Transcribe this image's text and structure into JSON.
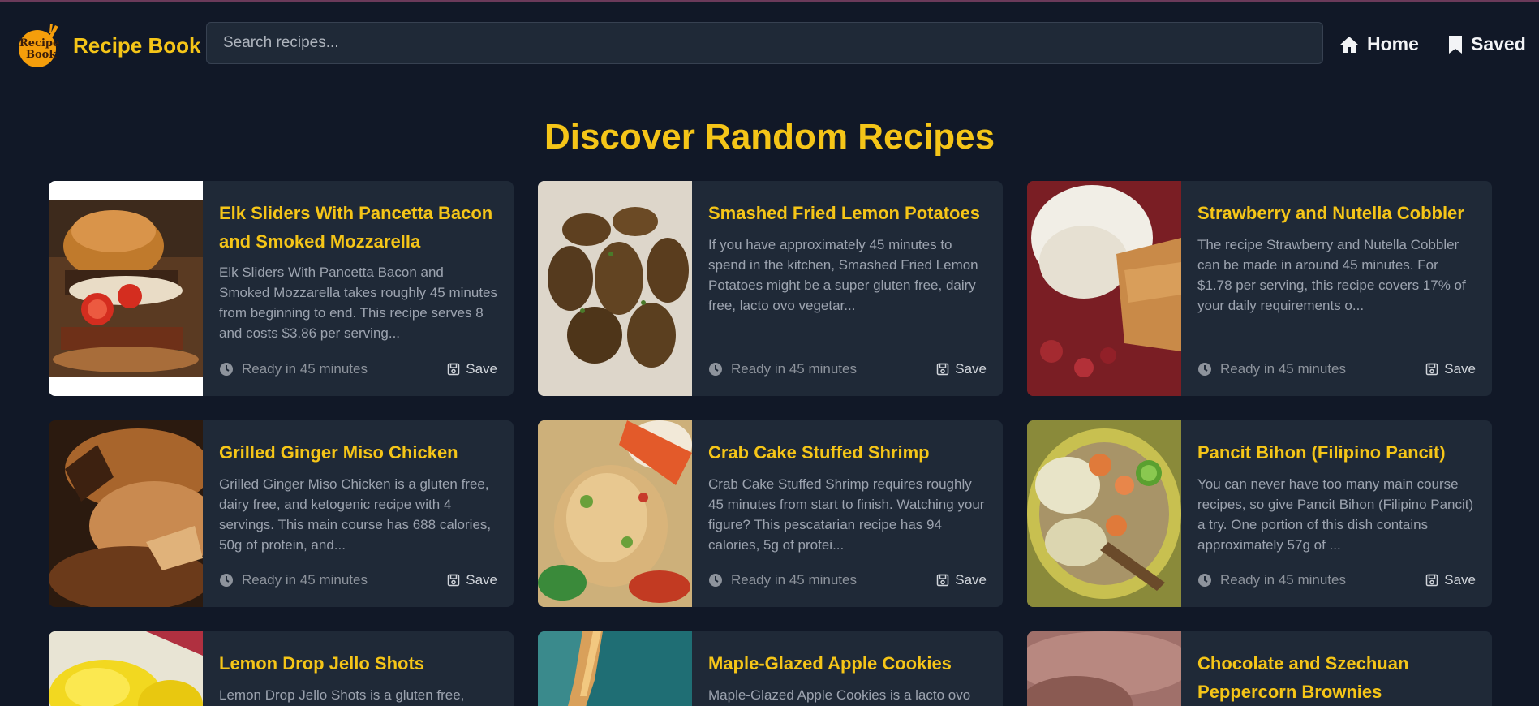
{
  "header": {
    "brand": "Recipe Book",
    "logo_text_line1": "Recipe",
    "logo_text_line2": "Book",
    "search_placeholder": "Search recipes...",
    "nav": [
      {
        "label": "Home",
        "icon": "home-icon"
      },
      {
        "label": "Saved",
        "icon": "bookmark-icon"
      }
    ]
  },
  "page_title": "Discover Random Recipes",
  "colors": {
    "accent": "#f5c518",
    "background": "#111827",
    "card": "#1f2937"
  },
  "recipes": [
    {
      "title": "Elk Sliders With Pancetta Bacon and Smoked Mozzarella",
      "description": "Elk Sliders With Pancetta Bacon and Smoked Mozzarella takes roughly 45 minutes from beginning to end. This recipe serves 8 and costs $3.86 per serving...",
      "ready": "Ready in 45 minutes",
      "save": "Save"
    },
    {
      "title": "Smashed Fried Lemon Potatoes",
      "description": "If you have approximately 45 minutes to spend in the kitchen, Smashed Fried Lemon Potatoes might be a super gluten free, dairy free, lacto ovo vegetar...",
      "ready": "Ready in 45 minutes",
      "save": "Save"
    },
    {
      "title": "Strawberry and Nutella Cobbler",
      "description": "The recipe Strawberry and Nutella Cobbler can be made in around 45 minutes. For $1.78 per serving, this recipe covers 17% of your daily requirements o...",
      "ready": "Ready in 45 minutes",
      "save": "Save"
    },
    {
      "title": "Grilled Ginger Miso Chicken",
      "description": "Grilled Ginger Miso Chicken is a gluten free, dairy free, and ketogenic recipe with 4 servings. This main course has 688 calories, 50g of protein, and...",
      "ready": "Ready in 45 minutes",
      "save": "Save"
    },
    {
      "title": "Crab Cake Stuffed Shrimp",
      "description": "Crab Cake Stuffed Shrimp requires roughly 45 minutes from start to finish. Watching your figure? This pescatarian recipe has 94 calories, 5g of protei...",
      "ready": "Ready in 45 minutes",
      "save": "Save"
    },
    {
      "title": "Pancit Bihon (Filipino Pancit)",
      "description": "You can never have too many main course recipes, so give Pancit Bihon (Filipino Pancit) a try. One portion of this dish contains approximately 57g of ...",
      "ready": "Ready in 45 minutes",
      "save": "Save"
    },
    {
      "title": "Lemon Drop Jello Shots",
      "description": "Lemon Drop Jello Shots is a gluten free,",
      "ready": "",
      "save": ""
    },
    {
      "title": "Maple-Glazed Apple Cookies",
      "description": "Maple-Glazed Apple Cookies is a lacto ovo",
      "ready": "",
      "save": ""
    },
    {
      "title": "Chocolate and Szechuan Peppercorn Brownies",
      "description": "",
      "ready": "",
      "save": ""
    }
  ]
}
